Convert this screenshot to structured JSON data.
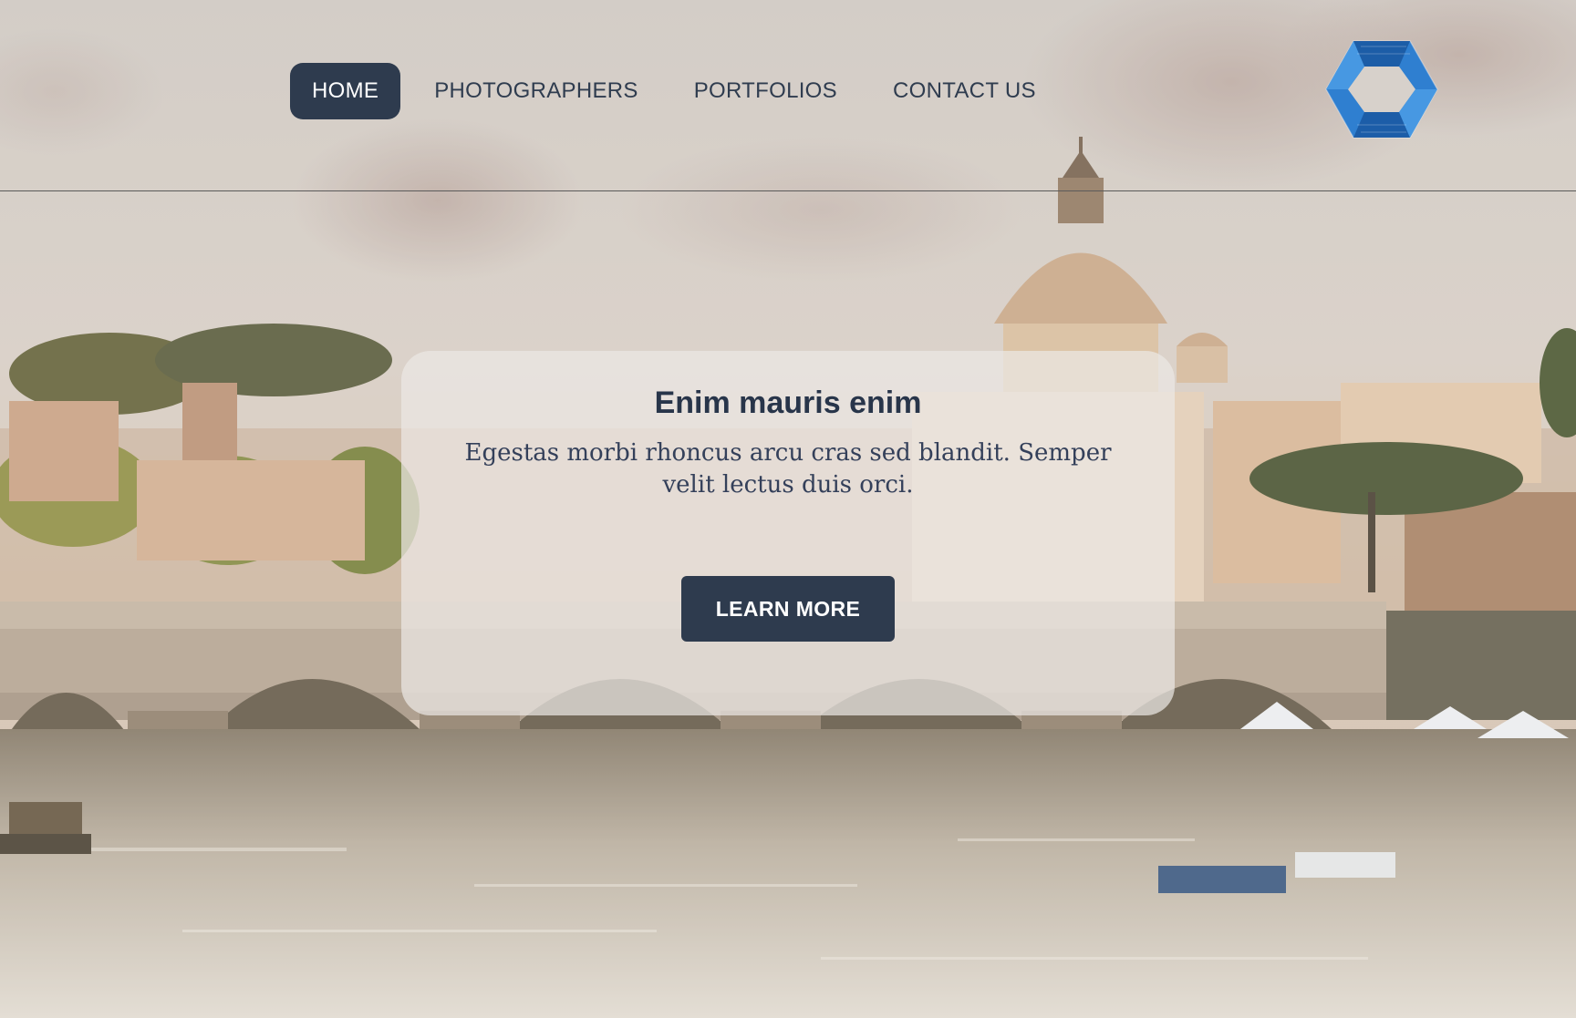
{
  "nav": {
    "items": [
      {
        "label": "HOME",
        "active": true
      },
      {
        "label": "PHOTOGRAPHERS",
        "active": false
      },
      {
        "label": "PORTFOLIOS",
        "active": false
      },
      {
        "label": "CONTACT US",
        "active": false
      }
    ]
  },
  "logo": {
    "icon": "hexagon-swirl-logo-icon",
    "color": "#2f7fd0"
  },
  "hero": {
    "background": "rome-tiber-bridge-dome-photo",
    "title": "Enim mauris enim",
    "text": "Egestas morbi rhoncus arcu cras sed blandit. Semper velit lectus duis orci.",
    "button_label": "LEARN MORE"
  },
  "colors": {
    "accent": "#2e3b4e",
    "text": "#28354a"
  }
}
